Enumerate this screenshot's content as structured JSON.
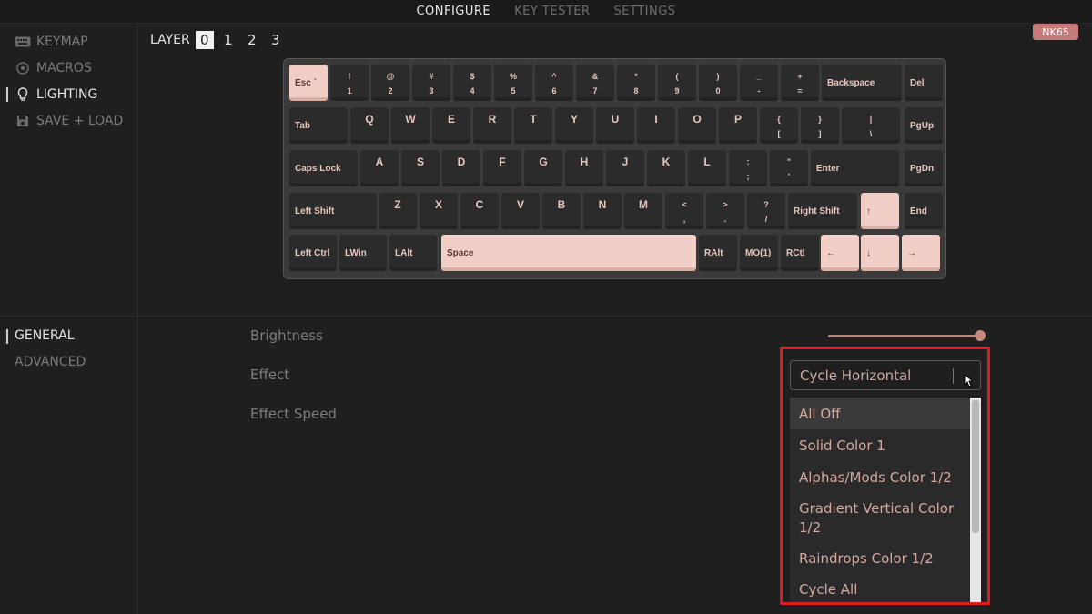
{
  "topnav": {
    "tabs": [
      {
        "label": "CONFIGURE",
        "active": true
      },
      {
        "label": "KEY TESTER",
        "active": false
      },
      {
        "label": "SETTINGS",
        "active": false
      }
    ]
  },
  "sidebar": {
    "items": [
      {
        "label": "KEYMAP",
        "icon": "keyboard-icon",
        "active": false
      },
      {
        "label": "MACROS",
        "icon": "target-icon",
        "active": false
      },
      {
        "label": "LIGHTING",
        "icon": "bulb-icon",
        "active": true
      },
      {
        "label": "SAVE + LOAD",
        "icon": "floppy-icon",
        "active": false
      }
    ]
  },
  "layers": {
    "label": "LAYER",
    "options": [
      "0",
      "1",
      "2",
      "3"
    ],
    "selected": "0"
  },
  "device_badge": "NK65",
  "keyboard": {
    "row1": [
      {
        "t": "Esc",
        "extra": "`"
      },
      {
        "top": "!",
        "bot": "1"
      },
      {
        "top": "@",
        "bot": "2"
      },
      {
        "top": "#",
        "bot": "3"
      },
      {
        "top": "$",
        "bot": "4"
      },
      {
        "top": "%",
        "bot": "5"
      },
      {
        "top": "^",
        "bot": "6"
      },
      {
        "top": "&",
        "bot": "7"
      },
      {
        "top": "*",
        "bot": "8"
      },
      {
        "top": "(",
        "bot": "9"
      },
      {
        "top": ")",
        "bot": "0"
      },
      {
        "top": "_",
        "bot": "-"
      },
      {
        "top": "+",
        "bot": "="
      },
      {
        "t": "Backspace"
      },
      {
        "t": "Del"
      }
    ],
    "row2": [
      {
        "t": "Tab"
      },
      {
        "s": "Q"
      },
      {
        "s": "W"
      },
      {
        "s": "E"
      },
      {
        "s": "R"
      },
      {
        "s": "T"
      },
      {
        "s": "Y"
      },
      {
        "s": "U"
      },
      {
        "s": "I"
      },
      {
        "s": "O"
      },
      {
        "s": "P"
      },
      {
        "top": "{",
        "bot": "["
      },
      {
        "top": "}",
        "bot": "]"
      },
      {
        "top": "|",
        "bot": "\\"
      },
      {
        "t": "PgUp"
      }
    ],
    "row3": [
      {
        "t": "Caps Lock"
      },
      {
        "s": "A"
      },
      {
        "s": "S"
      },
      {
        "s": "D"
      },
      {
        "s": "F"
      },
      {
        "s": "G"
      },
      {
        "s": "H"
      },
      {
        "s": "J"
      },
      {
        "s": "K"
      },
      {
        "s": "L"
      },
      {
        "top": ":",
        "bot": ";"
      },
      {
        "top": "\"",
        "bot": "'"
      },
      {
        "t": "Enter"
      },
      {
        "t": "PgDn"
      }
    ],
    "row4": [
      {
        "t": "Left Shift"
      },
      {
        "s": "Z"
      },
      {
        "s": "X"
      },
      {
        "s": "C"
      },
      {
        "s": "V"
      },
      {
        "s": "B"
      },
      {
        "s": "N"
      },
      {
        "s": "M"
      },
      {
        "top": "<",
        "bot": ","
      },
      {
        "top": ">",
        "bot": "."
      },
      {
        "top": "?",
        "bot": "/"
      },
      {
        "t": "Right Shift"
      },
      {
        "t": "↑"
      },
      {
        "t": "End"
      }
    ],
    "row5": [
      {
        "t": "Left Ctrl"
      },
      {
        "t": "LWin"
      },
      {
        "t": "LAlt"
      },
      {
        "t": "Space"
      },
      {
        "t": "RAlt"
      },
      {
        "t": "MO(1)"
      },
      {
        "t": "RCtl"
      },
      {
        "t": "←"
      },
      {
        "t": "↓"
      },
      {
        "t": "→"
      }
    ]
  },
  "subnav": {
    "items": [
      {
        "label": "GENERAL",
        "active": true
      },
      {
        "label": "ADVANCED",
        "active": false
      }
    ]
  },
  "settings": {
    "brightness_label": "Brightness",
    "brightness_value": 1.0,
    "effect_label": "Effect",
    "effect_speed_label": "Effect Speed",
    "effect_selected": "Cycle Horizontal"
  },
  "dropdown": {
    "options": [
      "All Off",
      "Solid Color 1",
      "Alphas/Mods Color 1/2",
      "Gradient Vertical Color 1/2",
      "Raindrops Color 1/2",
      "Cycle All"
    ],
    "hovered": "All Off"
  },
  "colors": {
    "accent_pink": "#f1cfc6",
    "highlight_red": "#d81e1e",
    "badge": "#c77c7c"
  }
}
